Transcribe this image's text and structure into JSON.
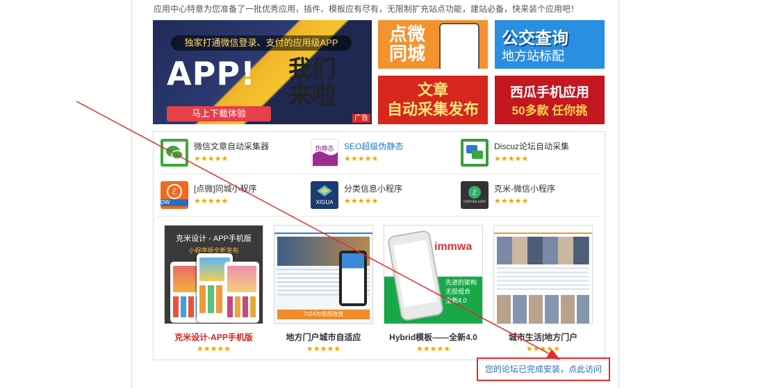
{
  "intro": "应用中心特意为您准备了一批优秀应用，插件、模板应有尽有，无限制扩充站点功能，建站必备，快来装个应用吧！",
  "banners": {
    "app": {
      "strip": "独家打通微信登录、支付的应用级APP",
      "big": "APP!",
      "cn_line1": "我们",
      "cn_line2": "来啦",
      "button": "马上下载体验",
      "ad": "广告"
    },
    "dianwei": {
      "line1": "点微",
      "line2": "同城"
    },
    "bus": {
      "line1": "公交查询",
      "line2": "地方站标配"
    },
    "article": {
      "line1": "文章",
      "line2": "自动采集发布"
    },
    "mobile": {
      "line1": "西瓜手机应用",
      "line2": "50多款 任你挑"
    }
  },
  "plugins": [
    {
      "name": "微信文章自动采集器",
      "stars": "★★★★★",
      "icon": "wechat-icon"
    },
    {
      "name": "SEO超级伪静态",
      "stars": "★★★★★",
      "icon": "seo-icon",
      "icon_text": "伪静态"
    },
    {
      "name": "Discuz论坛自动采集",
      "stars": "★★★★★",
      "icon": "chat-icon"
    },
    {
      "name": "[点微]同城小程序",
      "stars": "★★★★★",
      "icon": "miniprogram-icon",
      "icon_text": "DW"
    },
    {
      "name": "分类信息小程序",
      "stars": "★★★★★",
      "icon": "map-icon",
      "icon_text": "XIGUA"
    },
    {
      "name": "克米-微信小程序",
      "stars": "★★★★★",
      "icon": "miniprogram-dark-icon",
      "icon_text": "comsta.com"
    }
  ],
  "templates": [
    {
      "name": "克米设计-APP手机版",
      "stars": "★★★★★",
      "thumb_title": "克米设计 - APP手机版",
      "thumb_sub": "小程序版全新发布"
    },
    {
      "name": "地方门户城市自适应",
      "stars": "★★★★★",
      "thumb_banner": "7x24为您而改变"
    },
    {
      "name": "Hybrid模板——全新4.0",
      "stars": "★★★★★",
      "thumb_brand": "immwa",
      "thumb_lines": [
        "先进的架构",
        "无损组合",
        "全新4.0"
      ]
    },
    {
      "name": "城市生活|地方门户",
      "stars": "★★★★★"
    }
  ],
  "visit_link": "您的论坛已完成安装，点此访问",
  "colors": {
    "accent_red": "#e42a2a",
    "link_blue": "#2a6ab5",
    "star": "#f3a700"
  }
}
